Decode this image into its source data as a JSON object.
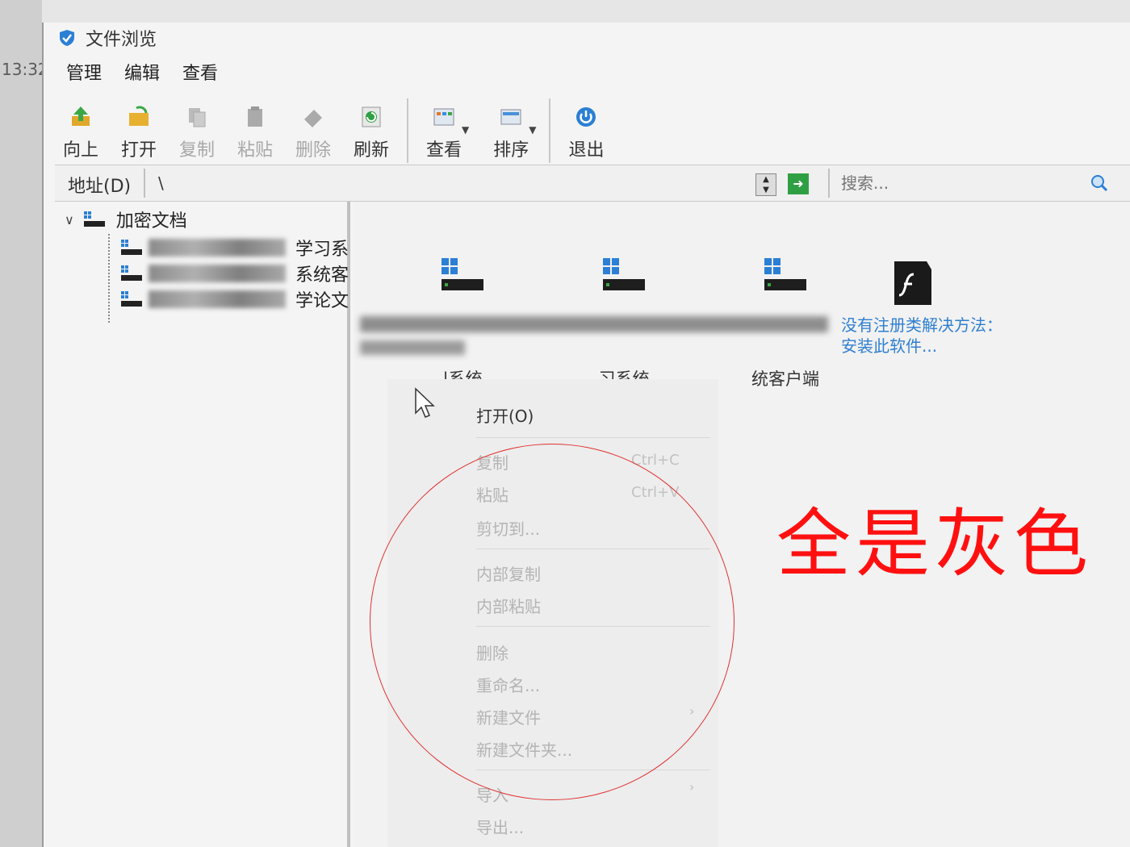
{
  "background": {
    "clock": "13:32"
  },
  "window": {
    "title": "文件浏览"
  },
  "menu": [
    "管理",
    "编辑",
    "查看"
  ],
  "toolbar": {
    "up": "向上",
    "open": "打开",
    "copy": "复制",
    "paste": "粘贴",
    "delete": "删除",
    "refresh": "刷新",
    "view": "查看",
    "sort": "排序",
    "exit": "退出"
  },
  "address": {
    "label": "地址(D)",
    "value": "\\",
    "search_placeholder": "搜索..."
  },
  "tree": {
    "root": "加密文档",
    "children": [
      "学习系",
      "系统客",
      "学论文"
    ]
  },
  "files": [
    {
      "label": "|系统"
    },
    {
      "label": "习系统"
    },
    {
      "label": "统客户端"
    }
  ],
  "unregistered": "没有注册类解决方法：安装此软件...",
  "context_menu": {
    "open": "打开(O)",
    "copy": "复制",
    "copy_shortcut": "Ctrl+C",
    "paste": "粘贴",
    "paste_shortcut": "Ctrl+V",
    "cut_to": "剪切到...",
    "internal_copy": "内部复制",
    "internal_paste": "内部粘贴",
    "delete": "删除",
    "rename": "重命名...",
    "new_file": "新建文件",
    "new_folder": "新建文件夹...",
    "import": "导入",
    "export": "导出..."
  },
  "annotation": {
    "text": "全是灰色",
    "color": "#ff1010"
  }
}
